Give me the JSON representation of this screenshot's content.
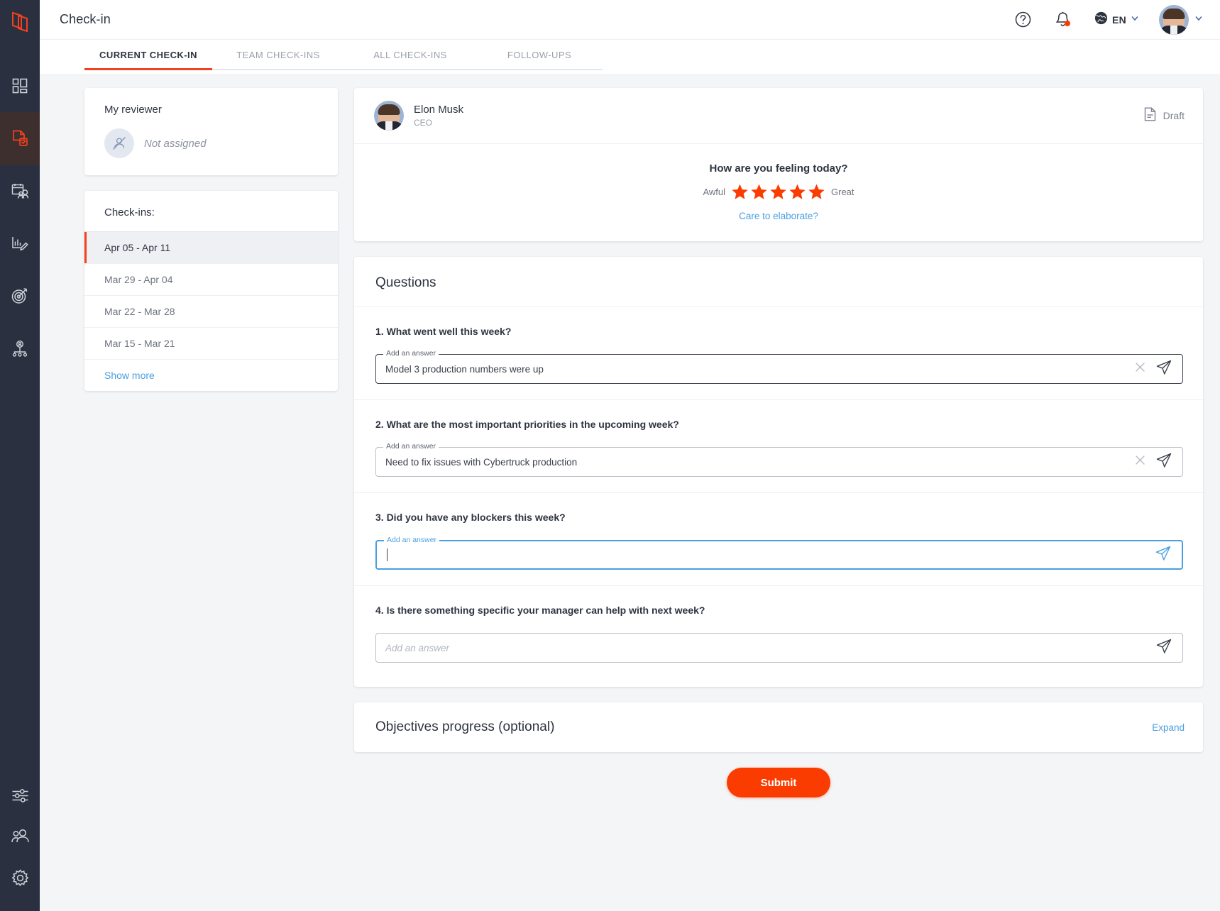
{
  "app": {
    "logo_icon": "app-logo-icon",
    "accent_color": "#fa3c00",
    "link_color": "#4a9fe0",
    "rail_bg": "#2b3040"
  },
  "sidebar": {
    "items": [
      {
        "icon": "dashboard-grid-icon",
        "name": "dashboard",
        "active": false
      },
      {
        "icon": "document-check-icon",
        "name": "check-in",
        "active": true
      },
      {
        "icon": "calendar-people-icon",
        "name": "meetings",
        "active": false
      },
      {
        "icon": "chart-edit-icon",
        "name": "reviews",
        "active": false
      },
      {
        "icon": "target-icon",
        "name": "objectives",
        "active": false
      },
      {
        "icon": "org-chart-icon",
        "name": "org-chart",
        "active": false
      }
    ],
    "bottom_items": [
      {
        "icon": "sliders-icon",
        "name": "preferences"
      },
      {
        "icon": "people-icon",
        "name": "users"
      },
      {
        "icon": "gear-icon",
        "name": "settings"
      }
    ]
  },
  "header": {
    "title": "Check-in",
    "help_icon": "help-circle-icon",
    "notifications_icon": "bell-icon",
    "notification_badge": true,
    "language_icon": "globe-icon",
    "language": "EN",
    "language_chevron": "chevron-down-icon",
    "avatar": "user-avatar",
    "avatar_chevron": "chevron-down-icon"
  },
  "tabs": [
    {
      "label": "CURRENT CHECK-IN",
      "active": true
    },
    {
      "label": "TEAM CHECK-INS",
      "active": false
    },
    {
      "label": "ALL CHECK-INS",
      "active": false
    },
    {
      "label": "FOLLOW-UPS",
      "active": false
    }
  ],
  "reviewer": {
    "title": "My reviewer",
    "avatar_icon": "user-slash-icon",
    "status": "Not assigned"
  },
  "checkins": {
    "title": "Check-ins:",
    "items": [
      {
        "label": "Apr 05 - Apr 11",
        "active": true
      },
      {
        "label": "Mar 29 - Apr 04",
        "active": false
      },
      {
        "label": "Mar 22 - Mar 28",
        "active": false
      },
      {
        "label": "Mar 15 - Mar 21",
        "active": false
      }
    ],
    "show_more": "Show more"
  },
  "mood": {
    "user_name": "Elon Musk",
    "user_role": "CEO",
    "status_icon": "document-icon",
    "status_label": "Draft",
    "question": "How are you feeling today?",
    "low_label": "Awful",
    "high_label": "Great",
    "stars_total": 5,
    "stars_selected": 5,
    "elaborate_link": "Care to elaborate?"
  },
  "questions_section": {
    "title": "Questions",
    "items": [
      {
        "text": "1. What went well this week?",
        "legend": "Add an answer",
        "value": "Model 3 production numbers were up",
        "placeholder": "",
        "focused": false,
        "has_clear": true,
        "clear_icon": "close-icon",
        "send_icon": "send-icon"
      },
      {
        "text": "2. What are the most important priorities in the upcoming week?",
        "legend": "Add an answer",
        "value": "Need to fix issues with Cybertruck production",
        "placeholder": "",
        "focused": false,
        "has_clear": true,
        "clear_icon": "close-icon",
        "send_icon": "send-icon"
      },
      {
        "text": "3. Did you have any blockers this week?",
        "legend": "Add an answer",
        "value": "",
        "placeholder": "",
        "focused": true,
        "has_clear": false,
        "clear_icon": "close-icon",
        "send_icon": "send-icon"
      },
      {
        "text": "4. Is there something specific your manager can help with next week?",
        "legend": "",
        "value": "",
        "placeholder": "Add an answer",
        "focused": false,
        "has_clear": false,
        "clear_icon": "close-icon",
        "send_icon": "send-icon"
      }
    ]
  },
  "objectives": {
    "title": "Objectives progress (optional)",
    "expand_label": "Expand"
  },
  "submit": {
    "label": "Submit"
  }
}
